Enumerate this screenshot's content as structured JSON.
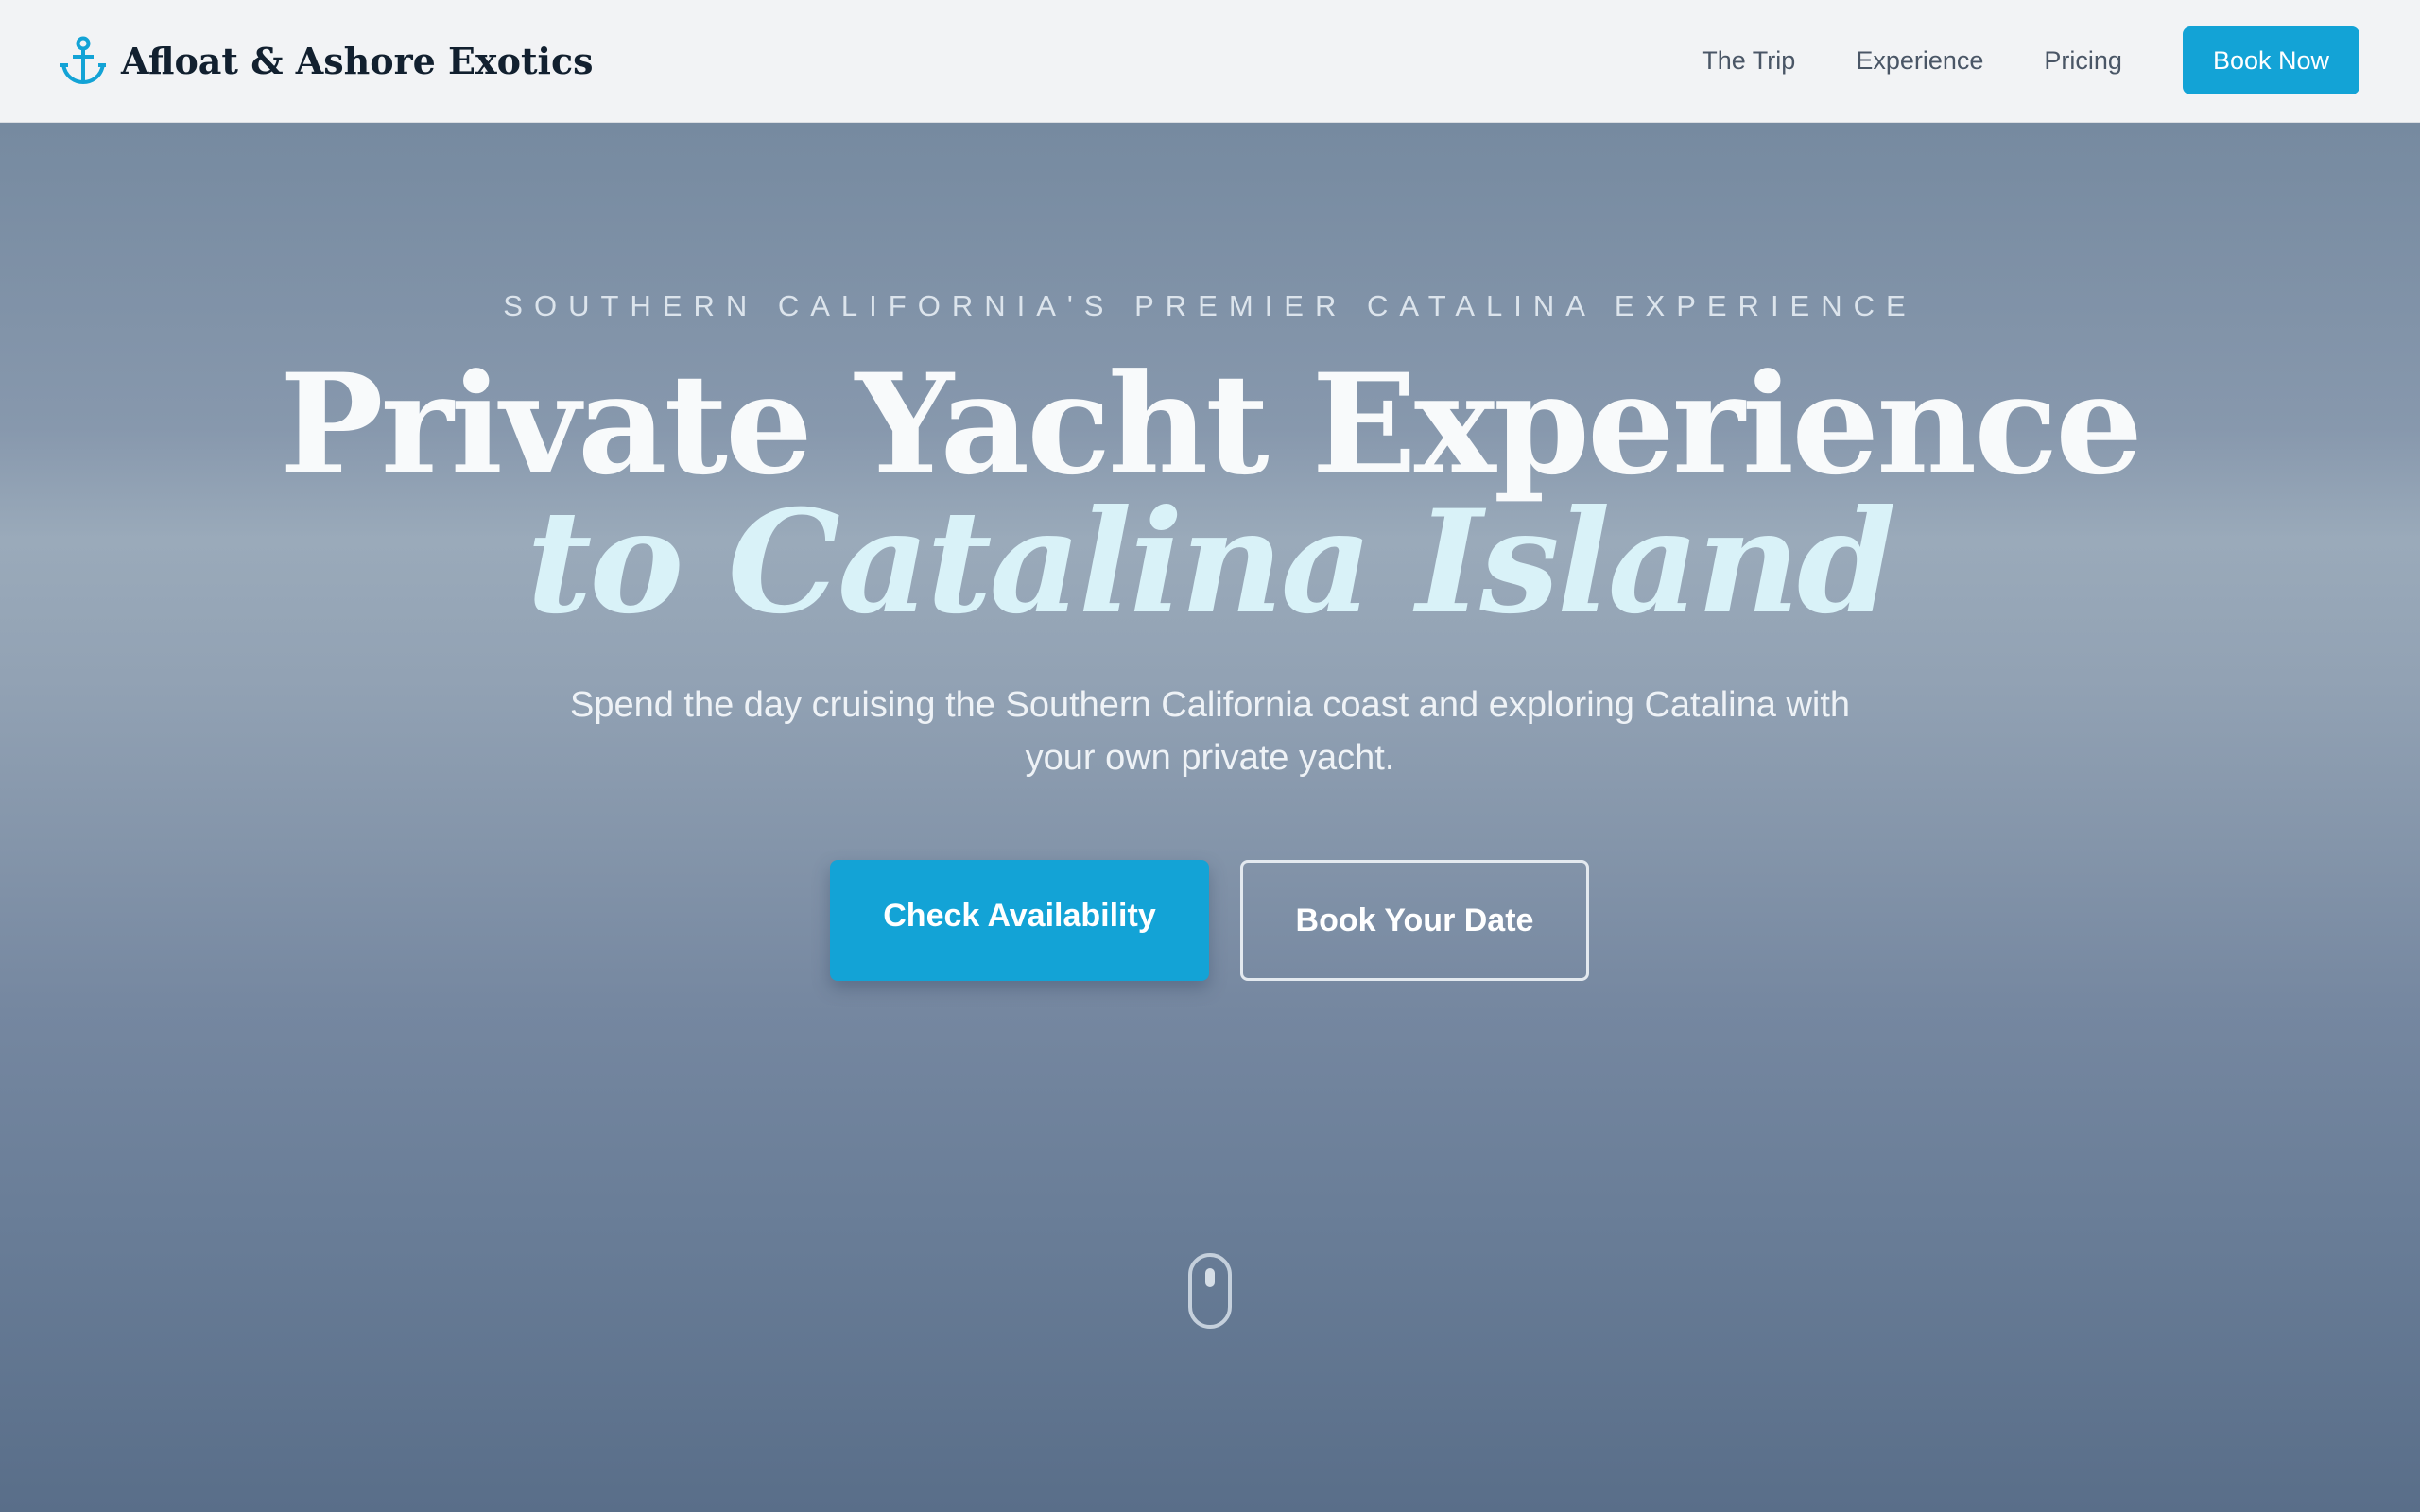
{
  "nav": {
    "brand_name": "Afloat & Ashore Exotics",
    "brand_icon": "anchor-icon",
    "links": [
      {
        "label": "The Trip"
      },
      {
        "label": "Experience"
      },
      {
        "label": "Pricing"
      }
    ],
    "cta_label": "Book Now"
  },
  "hero": {
    "eyebrow": "SOUTHERN CALIFORNIA'S PREMIER CATALINA EXPERIENCE",
    "headline_line1": "Private Yacht Experience",
    "headline_line2": "to Catalina Island",
    "subtitle": "Spend the day cruising the Southern California coast and exploring Catalina with your own private yacht.",
    "primary_button": "Check Availability",
    "secondary_button": "Book Your Date",
    "scroll_icon": "mouse-scroll-icon"
  },
  "colors": {
    "accent": "#13a3d6",
    "nav_background": "#f2f3f5",
    "brand_text": "#12202f",
    "headline_italic": "#d9f2f8"
  }
}
